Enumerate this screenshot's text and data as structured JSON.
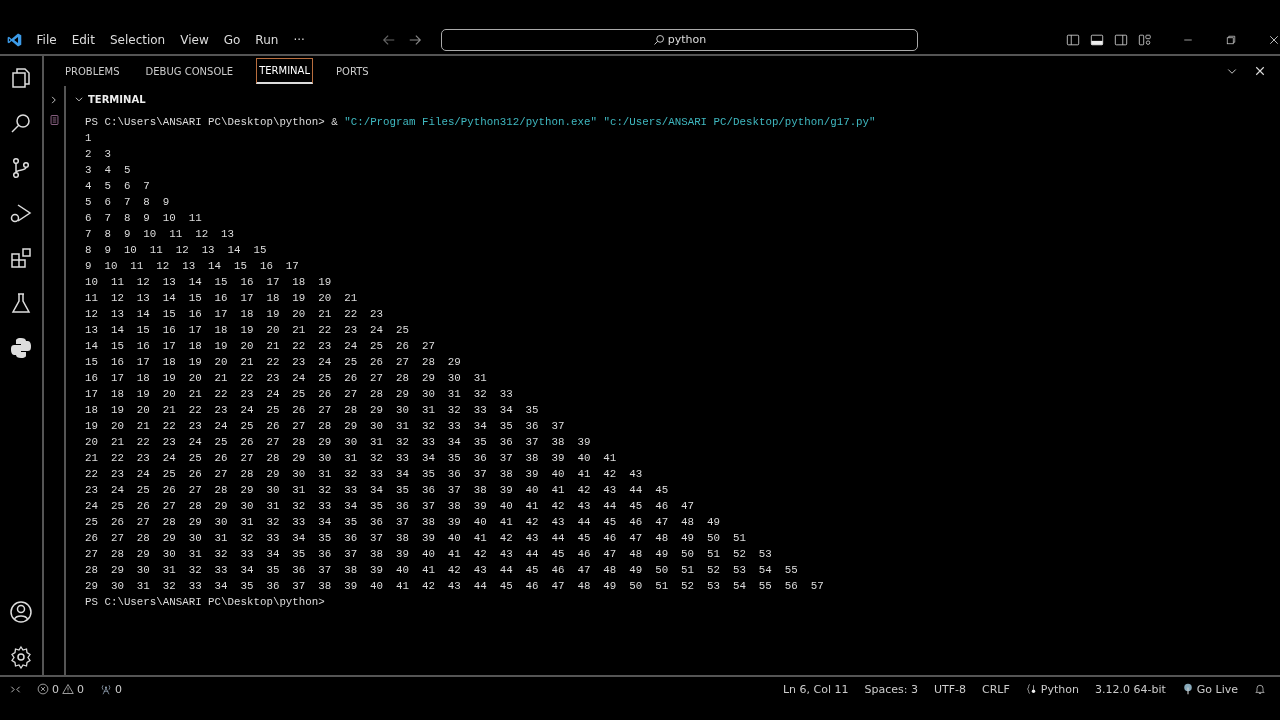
{
  "menu": [
    "File",
    "Edit",
    "Selection",
    "View",
    "Go",
    "Run",
    "···"
  ],
  "search": {
    "value": "python"
  },
  "panel_tabs": [
    {
      "label": "PROBLEMS",
      "selected": false
    },
    {
      "label": "DEBUG CONSOLE",
      "selected": false
    },
    {
      "label": "TERMINAL",
      "selected": true
    },
    {
      "label": "PORTS",
      "selected": false
    }
  ],
  "terminal": {
    "section_title": "TERMINAL",
    "command": {
      "prompt": "PS C:\\Users\\ANSARI PC\\Desktop\\python>",
      "operator": "&",
      "args": [
        "\"C:/Program Files/Python312/python.exe\"",
        "\"c:/Users/ANSARI PC/Desktop/python/g17.py\""
      ]
    },
    "output": [
      "1",
      "2  3",
      "3  4  5",
      "4  5  6  7",
      "5  6  7  8  9",
      "6  7  8  9  10  11",
      "7  8  9  10  11  12  13",
      "8  9  10  11  12  13  14  15",
      "9  10  11  12  13  14  15  16  17",
      "10  11  12  13  14  15  16  17  18  19",
      "11  12  13  14  15  16  17  18  19  20  21",
      "12  13  14  15  16  17  18  19  20  21  22  23",
      "13  14  15  16  17  18  19  20  21  22  23  24  25",
      "14  15  16  17  18  19  20  21  22  23  24  25  26  27",
      "15  16  17  18  19  20  21  22  23  24  25  26  27  28  29",
      "16  17  18  19  20  21  22  23  24  25  26  27  28  29  30  31",
      "17  18  19  20  21  22  23  24  25  26  27  28  29  30  31  32  33",
      "18  19  20  21  22  23  24  25  26  27  28  29  30  31  32  33  34  35",
      "19  20  21  22  23  24  25  26  27  28  29  30  31  32  33  34  35  36  37",
      "20  21  22  23  24  25  26  27  28  29  30  31  32  33  34  35  36  37  38  39",
      "21  22  23  24  25  26  27  28  29  30  31  32  33  34  35  36  37  38  39  40  41",
      "22  23  24  25  26  27  28  29  30  31  32  33  34  35  36  37  38  39  40  41  42  43",
      "23  24  25  26  27  28  29  30  31  32  33  34  35  36  37  38  39  40  41  42  43  44  45",
      "24  25  26  27  28  29  30  31  32  33  34  35  36  37  38  39  40  41  42  43  44  45  46  47",
      "25  26  27  28  29  30  31  32  33  34  35  36  37  38  39  40  41  42  43  44  45  46  47  48  49",
      "26  27  28  29  30  31  32  33  34  35  36  37  38  39  40  41  42  43  44  45  46  47  48  49  50  51",
      "27  28  29  30  31  32  33  34  35  36  37  38  39  40  41  42  43  44  45  46  47  48  49  50  51  52  53",
      "28  29  30  31  32  33  34  35  36  37  38  39  40  41  42  43  44  45  46  47  48  49  50  51  52  53  54  55",
      "29  30  31  32  33  34  35  36  37  38  39  40  41  42  43  44  45  46  47  48  49  50  51  52  53  54  55  56  57"
    ],
    "final_prompt": "PS C:\\Users\\ANSARI PC\\Desktop\\python>"
  },
  "status_bar": {
    "errors": "0",
    "warnings": "0",
    "ports": "0",
    "right": [
      {
        "kind": "text",
        "label": "Ln 6, Col 11"
      },
      {
        "kind": "text",
        "label": "Spaces: 3"
      },
      {
        "kind": "text",
        "label": "UTF-8"
      },
      {
        "kind": "text",
        "label": "CRLF"
      },
      {
        "kind": "language",
        "label": "Python"
      },
      {
        "kind": "text",
        "label": "3.12.0 64-bit"
      },
      {
        "kind": "live",
        "label": "Go Live"
      }
    ]
  }
}
